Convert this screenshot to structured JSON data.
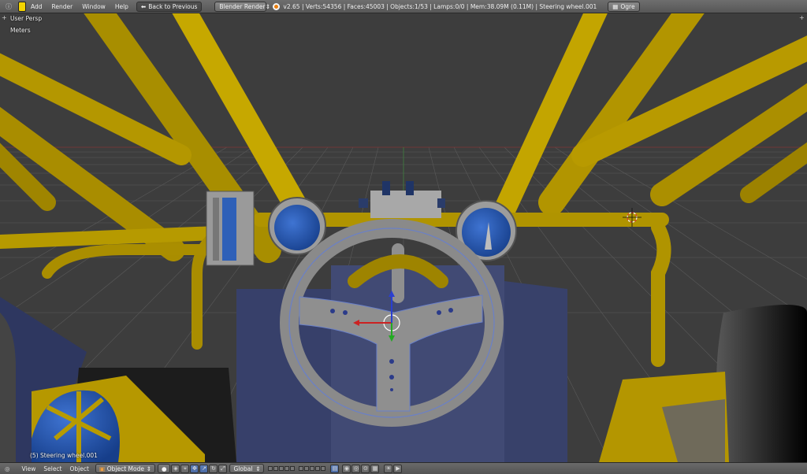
{
  "top": {
    "menus": [
      "Add",
      "Render",
      "Window",
      "Help"
    ],
    "back_button": "Back to Previous",
    "render_engine": "Blender Render",
    "stats": "v2.65 | Verts:54356 | Faces:45003 | Objects:1/53 | Lamps:0/0 | Mem:38.09M (0.11M) | Steering wheel.001",
    "scene_button": "Ogre"
  },
  "viewport": {
    "view_name": "User Persp",
    "units": "Meters",
    "active_object": "(5) Steering wheel.001"
  },
  "bottom": {
    "menus": [
      "View",
      "Select",
      "Object"
    ],
    "mode": "Object Mode",
    "orientation": "Global"
  },
  "colors": {
    "frame_yellow": "#c9a800",
    "viewport_bg": "#3d3d3d",
    "gauge_blue": "#2d5eb5",
    "wheel_gray": "#8d8d8d"
  }
}
